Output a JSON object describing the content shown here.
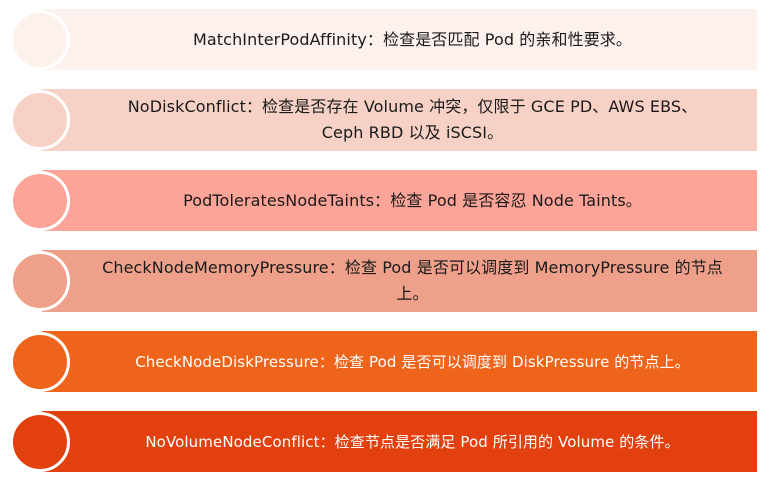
{
  "items": [
    {
      "text": "MatchInterPodAffinity：检查是否匹配 Pod 的亲和性要求。",
      "color": "#fdf1ee"
    },
    {
      "text": "NoDiskConflict：检查是否存在 Volume 冲突，仅限于 GCE PD、AWS EBS、Ceph RBD 以及 iSCSI。",
      "color": "#f7d1c6"
    },
    {
      "text": "PodToleratesNodeTaints：检查 Pod 是否容忍 Node Taints。",
      "color": "#fba497"
    },
    {
      "text": "CheckNodeMemoryPressure：检查 Pod 是否可以调度到 MemoryPressure 的节点上。",
      "color": "#eea08a"
    },
    {
      "text": "CheckNodeDiskPressure：检查 Pod 是否可以调度到 DiskPressure 的节点上。",
      "color": "#ee641b"
    },
    {
      "text": "NoVolumeNodeConflict：检查节点是否满足 Pod 所引用的 Volume 的条件。",
      "color": "#e3400f"
    }
  ]
}
